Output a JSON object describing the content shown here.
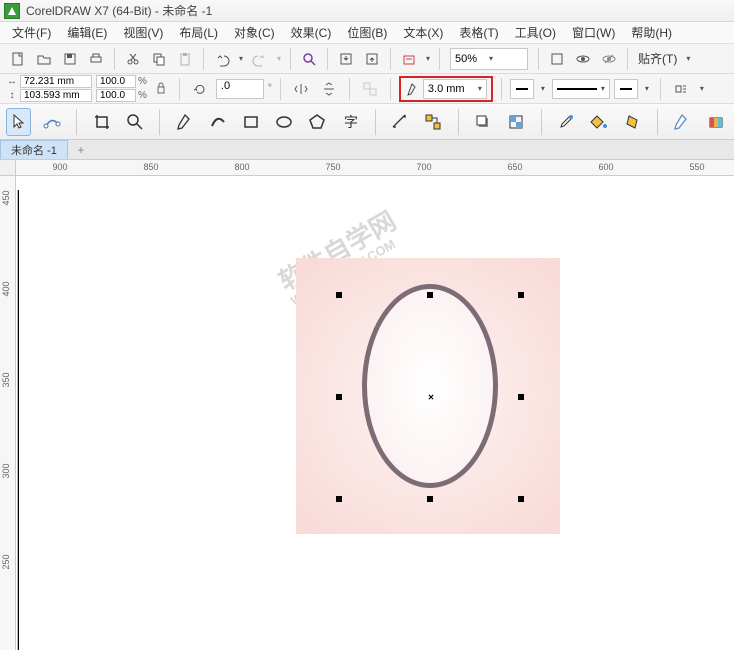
{
  "title": {
    "app": "CorelDRAW X7 (64-Bit)",
    "doc": "未命名 -1"
  },
  "menus": [
    "文件(F)",
    "编辑(E)",
    "视图(V)",
    "布局(L)",
    "对象(C)",
    "效果(C)",
    "位图(B)",
    "文本(X)",
    "表格(T)",
    "工具(O)",
    "窗口(W)",
    "帮助(H)"
  ],
  "toolbar1": {
    "zoom": "50%",
    "align": "贴齐(T)"
  },
  "props": {
    "w": "72.231 mm",
    "h": "103.593 mm",
    "sx": "100.0",
    "sy": "100.0",
    "rot": ".0",
    "outline_width": "3.0 mm"
  },
  "tab": "未命名 -1",
  "ruler_h": [
    "900",
    "850",
    "800",
    "750",
    "700",
    "650",
    "600",
    "550"
  ],
  "ruler_v": [
    "450",
    "400",
    "350",
    "300",
    "250"
  ],
  "watermark": {
    "line1": "软件自学网",
    "line2": "WWW.RJZXW.COM"
  },
  "center_mark": "×",
  "tab_add": "+"
}
